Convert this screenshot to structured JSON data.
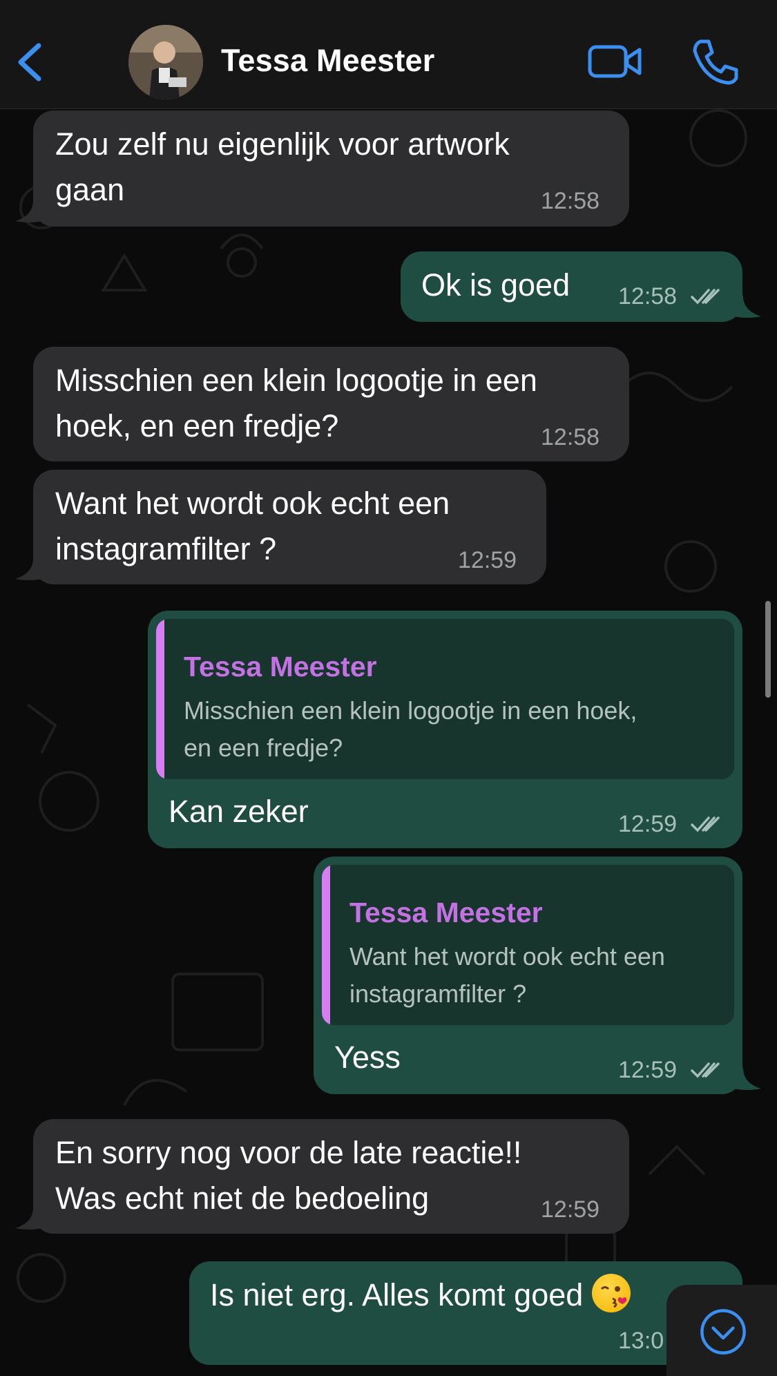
{
  "header": {
    "contact_name": "Tessa Meester",
    "back_icon": "chevron-left-icon",
    "video_icon": "video-camera-icon",
    "call_icon": "phone-icon"
  },
  "colors": {
    "accent": "#3b8ff0",
    "incoming_bubble": "#2e2e30",
    "outgoing_bubble": "#1f4d41",
    "quote_author": "#c371e3",
    "quote_bar": "#d77ef2"
  },
  "messages": [
    {
      "direction": "incoming",
      "lines": [
        "Zou zelf nu eigenlijk voor artwork",
        "gaan"
      ],
      "time": "12:58"
    },
    {
      "direction": "outgoing",
      "lines": [
        "Ok is goed"
      ],
      "time": "12:58",
      "status": "read"
    },
    {
      "direction": "incoming",
      "lines": [
        "Misschien een klein logootje in een",
        "hoek, en een fredje?"
      ],
      "time": "12:58"
    },
    {
      "direction": "incoming",
      "lines": [
        "Want het wordt ook echt een",
        "instagramfilter ?"
      ],
      "time": "12:59"
    },
    {
      "direction": "outgoing",
      "quote": {
        "author": "Tessa Meester",
        "lines": [
          "Misschien een klein logootje in een hoek,",
          "en een fredje?"
        ]
      },
      "lines": [
        "Kan zeker"
      ],
      "time": "12:59",
      "status": "read"
    },
    {
      "direction": "outgoing",
      "quote": {
        "author": "Tessa Meester",
        "lines": [
          "Want het wordt ook echt een",
          "instagramfilter ?"
        ]
      },
      "lines": [
        "Yess"
      ],
      "time": "12:59",
      "status": "read"
    },
    {
      "direction": "incoming",
      "lines": [
        "En sorry nog voor de late reactie!!",
        "Was echt niet de bedoeling"
      ],
      "time": "12:59"
    },
    {
      "direction": "outgoing",
      "lines": [
        "Is niet erg. Alles komt goed"
      ],
      "emoji": "winking-kiss-emoji",
      "time": "13:0"
    }
  ],
  "scroll_down_icon": "chevron-down-circle-icon"
}
